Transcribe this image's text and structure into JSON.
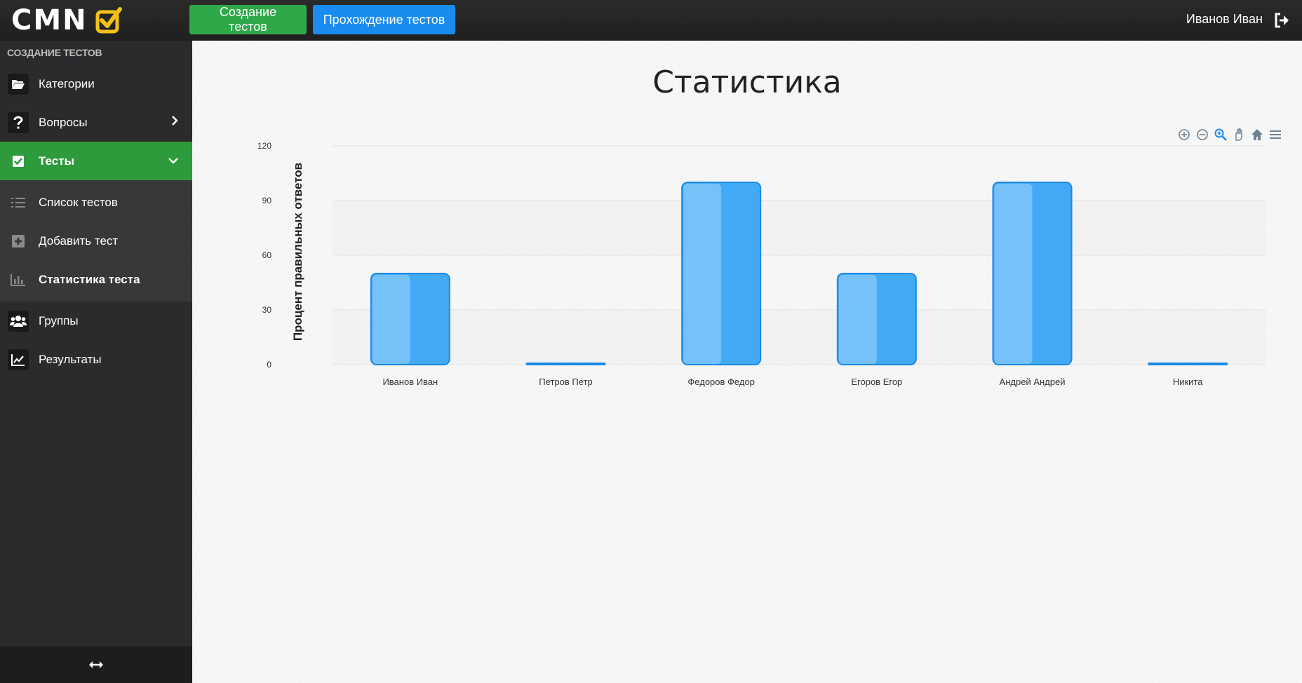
{
  "header": {
    "logo_text": "CMN",
    "btn_create": "Создание тестов",
    "btn_pass": "Прохождение тестов",
    "user_name": "Иванов Иван"
  },
  "sidebar": {
    "section_title": "СОЗДАНИЕ ТЕСТОВ",
    "items": [
      {
        "label": "Категории",
        "icon": "folder-icon"
      },
      {
        "label": "Вопросы",
        "icon": "question-icon"
      },
      {
        "label": "Тесты",
        "icon": "checkbox-icon"
      },
      {
        "label": "Группы",
        "icon": "users-icon"
      },
      {
        "label": "Результаты",
        "icon": "line-chart-icon"
      }
    ],
    "subitems": [
      {
        "label": "Список тестов",
        "icon": "list-icon"
      },
      {
        "label": "Добавить тест",
        "icon": "plus-square-icon"
      },
      {
        "label": "Статистика теста",
        "icon": "bar-chart-icon"
      }
    ]
  },
  "main": {
    "title": "Статистика"
  },
  "colors": {
    "accent_green": "#2fa84a",
    "accent_blue": "#1a8cf0",
    "bar_fill": "#42a9f6",
    "bar_light": "#76c1fa",
    "bar_stroke": "#1b8ae6"
  },
  "chart_data": {
    "type": "bar",
    "categories": [
      "Иванов Иван",
      "Петров Петр",
      "Федоров Федор",
      "Егоров Егор",
      "Андрей Андрей",
      "Никита"
    ],
    "values": [
      50,
      0,
      100,
      50,
      100,
      0
    ],
    "ylabel": "Процент правильных ответов",
    "yticks": [
      0,
      30,
      60,
      90,
      120
    ],
    "ylim": [
      0,
      120
    ],
    "grid": true
  }
}
